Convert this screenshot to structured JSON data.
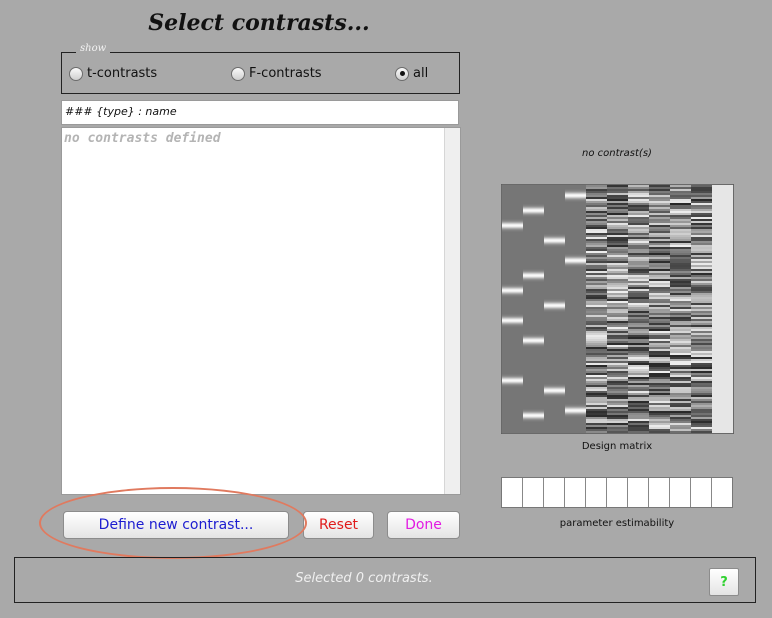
{
  "window": {
    "title": "Select contrasts..."
  },
  "show_group": {
    "legend": "show",
    "options": [
      {
        "label": "t-contrasts",
        "checked": false
      },
      {
        "label": "F-contrasts",
        "checked": false
      },
      {
        "label": "all",
        "checked": true
      }
    ]
  },
  "contrast_list": {
    "header": "### {type} : name",
    "empty_text": "no contrasts defined"
  },
  "buttons": {
    "define": "Define new contrast...",
    "reset": "Reset",
    "done": "Done",
    "help": "?"
  },
  "design_panel": {
    "contrast_label": "no contrast(s)",
    "design_matrix_caption": "Design matrix",
    "estimability_caption": "parameter estimability",
    "estimability_cells": 11
  },
  "status": {
    "text": "Selected 0 contrasts."
  },
  "colors": {
    "background": "#a9a9a9",
    "define_text": "#1d1dd0",
    "reset_text": "#e01b1b",
    "done_text": "#e21be2",
    "help_text": "#2fd12f",
    "annotation": "#e07a5f"
  }
}
